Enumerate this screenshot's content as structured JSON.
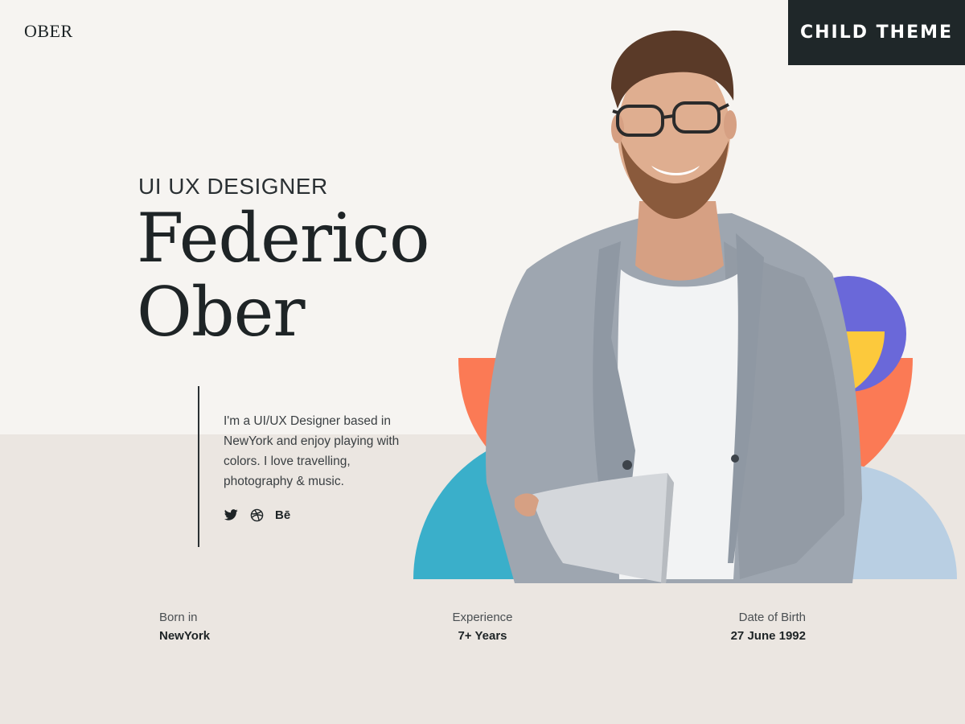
{
  "header": {
    "logo": "OBER",
    "badge": "CHILD THEME"
  },
  "hero": {
    "role": "UI UX DESIGNER",
    "name_line1": "Federico",
    "name_line2": "Ober",
    "bio": "I'm a UI/UX Designer based in NewYork and enjoy playing with colors. I love travelling, photography & music."
  },
  "socials": [
    {
      "icon": "twitter-icon"
    },
    {
      "icon": "dribbble-icon"
    },
    {
      "icon": "behance-icon",
      "label": "Bē"
    }
  ],
  "stats": {
    "born_label": "Born in",
    "born_value": "NewYork",
    "experience_label": "Experience",
    "experience_value": "7+ Years",
    "dob_label": "Date of Birth",
    "dob_value": "27 June 1992"
  },
  "colors": {
    "background_top": "#f6f4f1",
    "background_bottom": "#ebe6e1",
    "badge_bg": "#1f2729",
    "shape_orange": "#fb7a55",
    "shape_purple": "#6a68d9",
    "shape_yellow": "#fcc93c",
    "shape_teal": "#3aafca",
    "shape_lightblue": "#b9cfe3"
  }
}
